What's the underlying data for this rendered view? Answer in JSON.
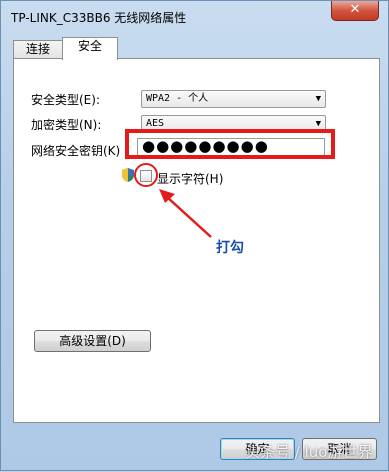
{
  "window": {
    "title": "TP-LINK_C33BB6 无线网络属性",
    "close_label": "✕"
  },
  "tabs": [
    {
      "label": "连接",
      "active": false
    },
    {
      "label": "安全",
      "active": true
    }
  ],
  "form": {
    "security_type_label": "安全类型(E):",
    "security_type_value": "WPA2 - 个人",
    "encryption_type_label": "加密类型(N):",
    "encryption_type_value": "AES",
    "key_label": "网络安全密钥(K)",
    "key_value": "●●●●●●●●●",
    "show_chars_label": "显示字符(H)",
    "show_chars_checked": false
  },
  "annotation": {
    "text": "打勾",
    "color": "#e31b1b",
    "text_color": "#1a4fa8"
  },
  "buttons": {
    "advanced": "高级设置(D)",
    "ok": "确定",
    "cancel": "取消"
  },
  "watermark": "头条号 / luo游世界"
}
